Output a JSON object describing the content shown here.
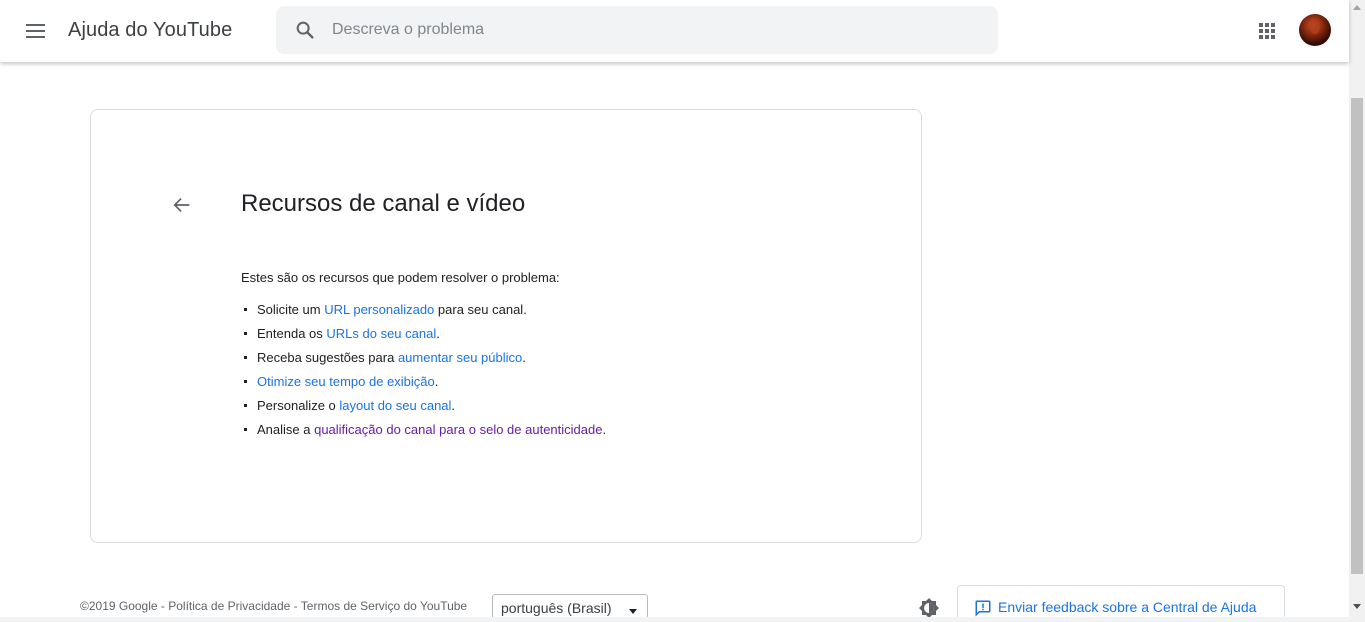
{
  "header": {
    "title": "Ajuda do YouTube",
    "search_placeholder": "Descreva o problema",
    "search_value": ""
  },
  "card": {
    "title": "Recursos de canal e vídeo",
    "intro": "Estes são os recursos que podem resolver o problema:",
    "items": [
      {
        "prefix": "Solicite um ",
        "link": "URL personalizado",
        "suffix": " para seu canal.",
        "visited": false
      },
      {
        "prefix": "Entenda os ",
        "link": "URLs do seu canal",
        "suffix": ".",
        "visited": false
      },
      {
        "prefix": "Receba sugestões para ",
        "link": "aumentar seu público",
        "suffix": ".",
        "visited": false
      },
      {
        "prefix": "",
        "link": "Otimize seu tempo de exibição",
        "suffix": ".",
        "visited": false
      },
      {
        "prefix": "Personalize o ",
        "link": "layout do seu canal",
        "suffix": ".",
        "visited": false
      },
      {
        "prefix": "Analise a ",
        "link": "qualificação do canal para o selo de autenticidade",
        "suffix": ".",
        "visited": true
      }
    ]
  },
  "footer": {
    "copyright": "©2019 Google",
    "separator": " - ",
    "privacy": "Política de Privacidade",
    "terms": "Termos de Serviço do YouTube",
    "language": "português (Brasil)",
    "feedback": "Enviar feedback sobre a Central de Ajuda"
  },
  "icons": {
    "menu": "hamburger-menu-icon",
    "search": "search-icon",
    "apps": "apps-grid-icon",
    "back": "arrow-back-icon",
    "theme": "brightness-icon",
    "feedback": "feedback-icon"
  },
  "colors": {
    "link": "#1a73e8",
    "visited_link": "#681da8",
    "search_bg": "#f1f3f4",
    "text": "#202124"
  }
}
